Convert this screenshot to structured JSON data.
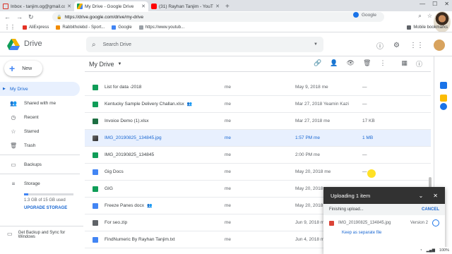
{
  "browser": {
    "tabs": [
      {
        "title": "Inbox - tanjim.og@gmail.com",
        "color": "#d93025"
      },
      {
        "title": "My Drive - Google Drive",
        "color": "#1a73e8"
      },
      {
        "title": "(31) Rayhan Tanjim - YouTube",
        "color": "#ff0000"
      }
    ],
    "new_tab": "+",
    "url": "https://drive.google.com/drive/my-drive",
    "search_engine": "Google",
    "bookmarks": [
      {
        "label": "AliExpress",
        "color": "#e43225"
      },
      {
        "label": "Rabbitholebd - Sport...",
        "color": "#f28b00"
      },
      {
        "label": "Google",
        "color": "#4285f4"
      },
      {
        "label": "https://www.youtub...",
        "color": "#5f6368"
      }
    ],
    "bookmarks_right": "Mobile bookmarks"
  },
  "drive": {
    "brand": "Drive",
    "search_placeholder": "Search Drive",
    "new_label": "New",
    "nav": [
      {
        "label": "My Drive",
        "icon": "folder-drive-icon",
        "glyph": "▤"
      },
      {
        "label": "Shared with me",
        "icon": "people-icon",
        "glyph": "👥"
      },
      {
        "label": "Recent",
        "icon": "clock-icon",
        "glyph": "◷"
      },
      {
        "label": "Starred",
        "icon": "star-icon",
        "glyph": "☆"
      },
      {
        "label": "Trash",
        "icon": "trash-icon",
        "glyph": "🗑"
      }
    ],
    "backups": "Backups",
    "storage": "Storage",
    "storage_used": "1.3 GB of 15 GB used",
    "storage_fraction": 0.087,
    "upgrade": "UPGRADE STORAGE",
    "backup_sync": "Get Backup and Sync for Windows",
    "breadcrumb": "My Drive",
    "files": [
      {
        "name": "List for data -2018",
        "type": "sheet",
        "color": "#0f9d58",
        "owner": "me",
        "modified": "May 9, 2018 me",
        "size": "—",
        "shared": false
      },
      {
        "name": "Kentucky Sample Delivery Challan.xlsx",
        "type": "sheet",
        "color": "#0f9d58",
        "owner": "me",
        "modified": "Mar 27, 2018 Yeamin Kazi",
        "size": "—",
        "shared": true
      },
      {
        "name": "Invoice Demo (1).xlsx",
        "type": "excel",
        "color": "#1d6f42",
        "owner": "me",
        "modified": "Mar 27, 2018 me",
        "size": "17 KB",
        "shared": false
      },
      {
        "name": "IMG_20190825_134845.jpg",
        "type": "image",
        "color": "#555555",
        "owner": "me",
        "modified": "1:57 PM me",
        "size": "1 MB",
        "shared": false,
        "selected": true
      },
      {
        "name": "IMG_20190825_134845",
        "type": "sheet",
        "color": "#0f9d58",
        "owner": "me",
        "modified": "2:00 PM me",
        "size": "—",
        "shared": false
      },
      {
        "name": "Gig Docs",
        "type": "doc",
        "color": "#4285f4",
        "owner": "me",
        "modified": "May 20, 2018 me",
        "size": "—",
        "shared": false
      },
      {
        "name": "GIG",
        "type": "sheet",
        "color": "#0f9d58",
        "owner": "me",
        "modified": "May 20, 2018 me",
        "size": "—",
        "shared": false
      },
      {
        "name": "Freeze Panes docx",
        "type": "doc",
        "color": "#4285f4",
        "owner": "me",
        "modified": "May 20, 2018 me",
        "size": "—",
        "shared": true
      },
      {
        "name": "For seo.zip",
        "type": "zip",
        "color": "#5f6368",
        "owner": "me",
        "modified": "Jun 9, 2018 me",
        "size": "",
        "shared": false
      },
      {
        "name": "FindNumeric By Rayhan Tanjim.txt",
        "type": "doc",
        "color": "#4285f4",
        "owner": "me",
        "modified": "Jun 4, 2018 me",
        "size": "",
        "shared": false
      }
    ]
  },
  "upload": {
    "title": "Uploading 1 item",
    "status": "Finishing upload...",
    "cancel": "CANCEL",
    "file": "IMG_20190825_134845.jpg",
    "version": "Version 2",
    "keep": "Keep as separate file"
  },
  "taskbar": {
    "zoom": "100%"
  }
}
